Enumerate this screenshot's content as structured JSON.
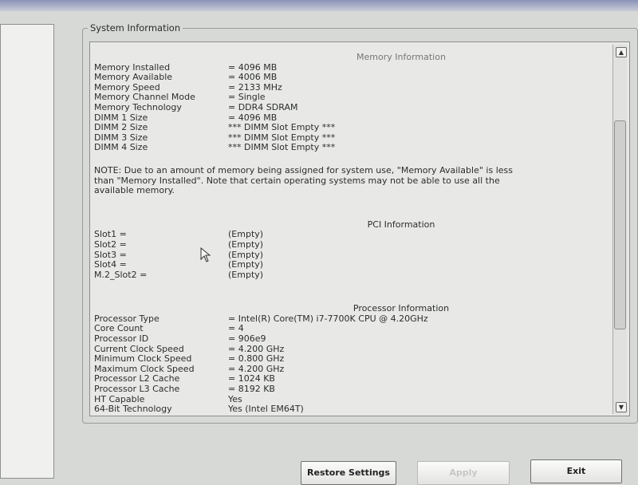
{
  "window": {
    "group_title": "System Information"
  },
  "memory": {
    "heading": "Memory Information",
    "rows": [
      {
        "label": "Memory Installed",
        "value": "= 4096 MB"
      },
      {
        "label": "Memory Available",
        "value": "= 4006 MB"
      },
      {
        "label": "Memory Speed",
        "value": "= 2133 MHz"
      },
      {
        "label": "Memory Channel Mode",
        "value": "= Single"
      },
      {
        "label": "Memory Technology",
        "value": "= DDR4 SDRAM"
      },
      {
        "label": "DIMM 1 Size",
        "value": "= 4096 MB"
      },
      {
        "label": "DIMM 2 Size",
        "value": "*** DIMM Slot Empty ***"
      },
      {
        "label": "DIMM 3 Size",
        "value": "*** DIMM Slot Empty ***"
      },
      {
        "label": "DIMM 4 Size",
        "value": "*** DIMM Slot Empty ***"
      }
    ],
    "note_line1": "NOTE: Due to an amount of memory being assigned for system use, \"Memory Available\" is less",
    "note_line2": "than \"Memory Installed\". Note that certain operating systems may not be able to use all the",
    "note_line3": "available memory."
  },
  "pci": {
    "heading": "PCI Information",
    "rows": [
      {
        "label": "Slot1 =",
        "value": "(Empty)"
      },
      {
        "label": "Slot2 =",
        "value": "(Empty)"
      },
      {
        "label": "Slot3 =",
        "value": "(Empty)"
      },
      {
        "label": "Slot4 =",
        "value": "(Empty)"
      },
      {
        "label": "M.2_Slot2 =",
        "value": "(Empty)"
      }
    ]
  },
  "processor": {
    "heading": "Processor Information",
    "rows": [
      {
        "label": "Processor Type",
        "value": "= Intel(R) Core(TM) i7-7700K CPU @ 4.20GHz"
      },
      {
        "label": "Core Count",
        "value": "= 4"
      },
      {
        "label": "Processor ID",
        "value": "= 906e9"
      },
      {
        "label": "Current Clock Speed",
        "value": "= 4.200 GHz"
      },
      {
        "label": "Minimum Clock Speed",
        "value": "= 0.800 GHz"
      },
      {
        "label": "Maximum Clock Speed",
        "value": "= 4.200 GHz"
      },
      {
        "label": "Processor L2 Cache",
        "value": "= 1024 KB"
      },
      {
        "label": "Processor L3 Cache",
        "value": "= 8192 KB"
      },
      {
        "label": "HT Capable",
        "value": "Yes"
      },
      {
        "label": "64-Bit Technology",
        "value": "Yes (Intel EM64T)"
      }
    ]
  },
  "buttons": {
    "restore": "Restore Settings",
    "apply": "Apply",
    "exit": "Exit"
  },
  "icons": {
    "scroll_up": "scroll-up-arrow-icon",
    "scroll_down": "scroll-down-arrow-icon",
    "cursor": "mouse-pointer-icon"
  }
}
